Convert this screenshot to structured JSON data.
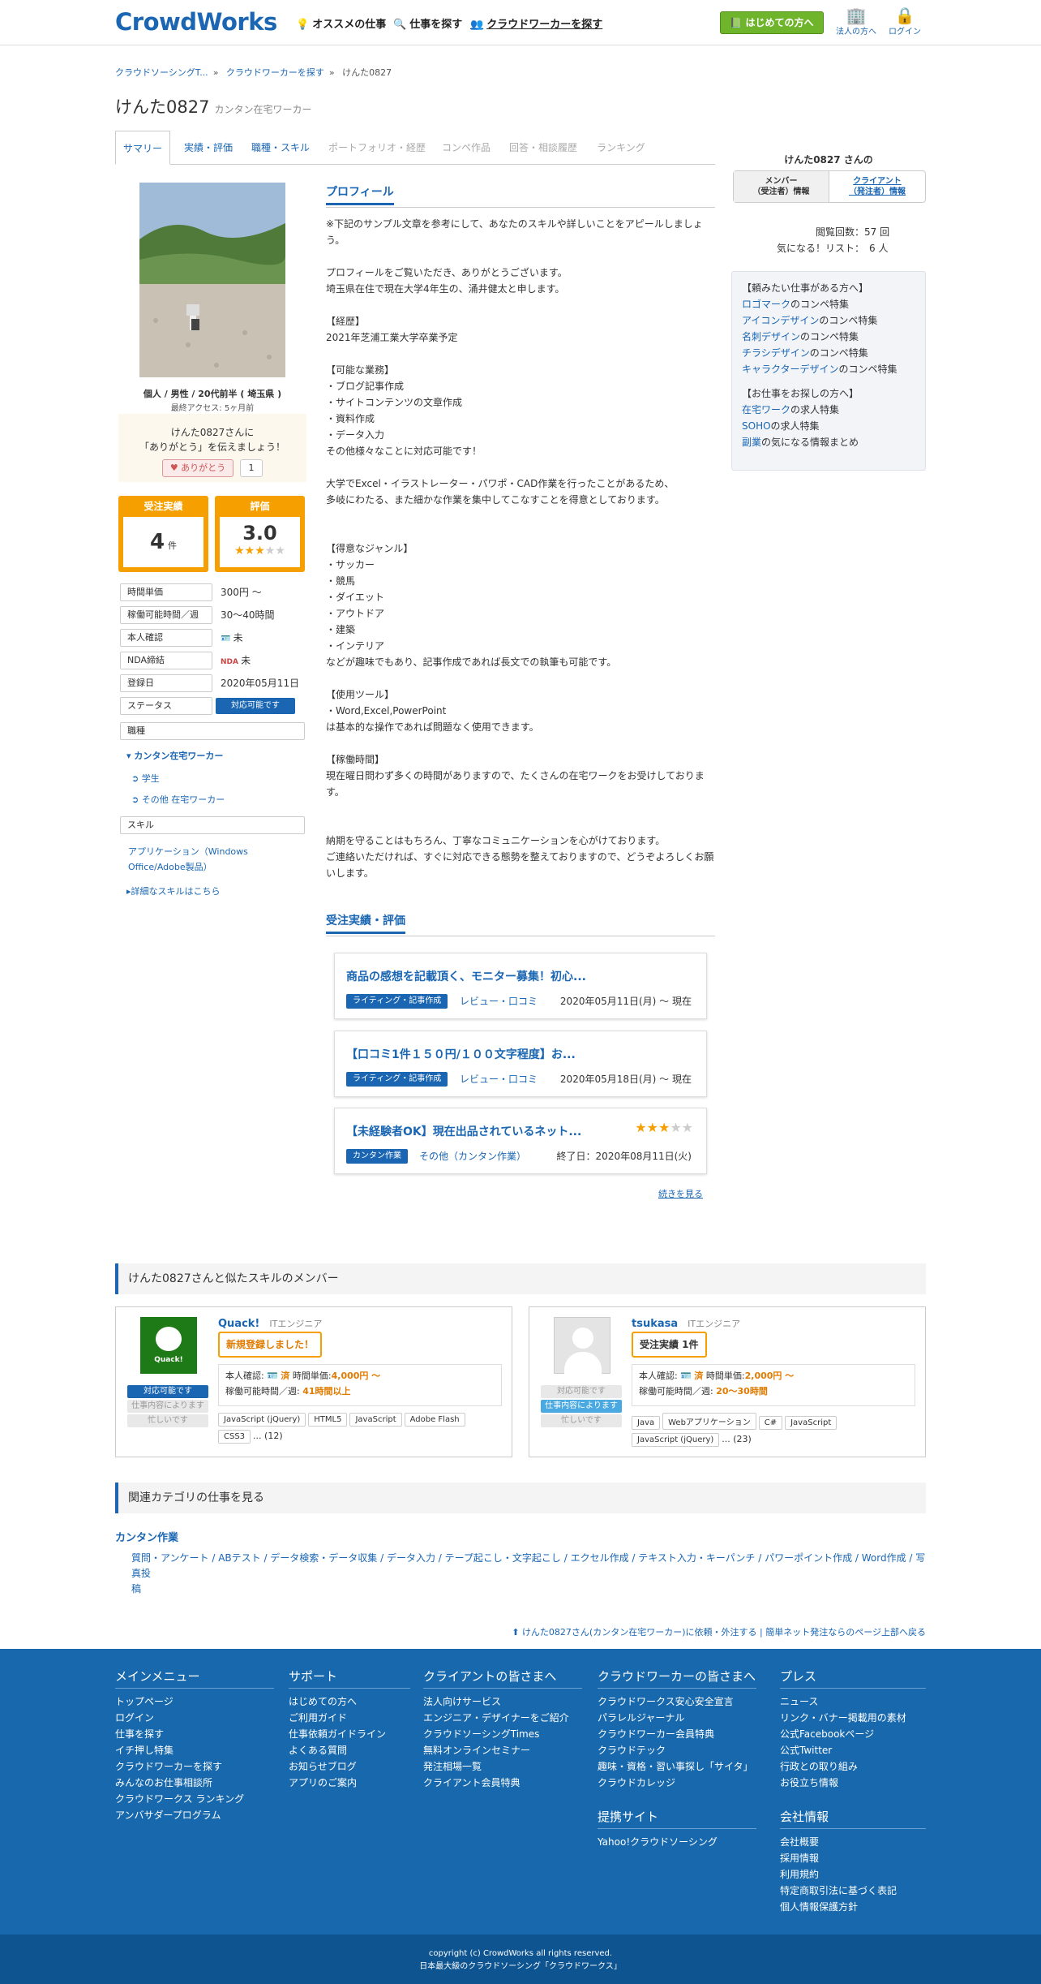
{
  "header": {
    "logo": "CrowdWorks",
    "nav": [
      {
        "icon": "lightbulb-icon",
        "label": "オススメの仕事"
      },
      {
        "icon": "search-icon",
        "label": "仕事を探す"
      },
      {
        "icon": "people-icon",
        "label": "クラウドワーカーを探す"
      }
    ],
    "begin_button": "はじめての方へ",
    "corp_label": "法人の方へ",
    "login_label": "ログイン"
  },
  "breadcrumb": [
    "クラウドソーシングT...",
    "クラウドワーカーを探す",
    "けんた0827"
  ],
  "profile": {
    "name": "けんた0827",
    "role": "カンタン在宅ワーカー"
  },
  "tabs": [
    {
      "label": "サマリー",
      "state": "active"
    },
    {
      "label": "実績・評価",
      "state": "link"
    },
    {
      "label": "職種・スキル",
      "state": "link"
    },
    {
      "label": "ポートフォリオ・経歴",
      "state": "disabled"
    },
    {
      "label": "コンペ作品",
      "state": "disabled"
    },
    {
      "label": "回答・相談履歴",
      "state": "disabled"
    },
    {
      "label": "ランキング",
      "state": "disabled"
    }
  ],
  "left": {
    "info": "個人 / 男性 / 20代前半 ( 埼玉県 )",
    "last_access": "最終アクセス: 5ヶ月前",
    "thanks_line1": "けんた0827さんに",
    "thanks_line2": "「ありがとう」を伝えましょう！",
    "thanks_button": "ありがとう",
    "thanks_count": "1",
    "orders_label": "受注実績",
    "orders_value": "4",
    "orders_unit": "件",
    "rating_label": "評価",
    "rating_value": "3.0",
    "rating_stars": 3,
    "rows": [
      {
        "label": "時間単価",
        "value": "300円 〜"
      },
      {
        "label": "稼働可能時間／週",
        "value": "30〜40時間"
      },
      {
        "label": "本人確認",
        "value": "未"
      },
      {
        "label": "NDA締結",
        "value": "未"
      },
      {
        "label": "登録日",
        "value": "2020年05月11日"
      },
      {
        "label": "ステータス",
        "value": "対応可能です"
      }
    ],
    "job_section": "職種",
    "job_main": "カンタン在宅ワーカー",
    "job_sub": [
      "学生",
      "その他 在宅ワーカー"
    ],
    "skill_section": "スキル",
    "skill_line1": "アプリケーション（Windows",
    "skill_line2": "Office/Adobe製品）",
    "skill_more": "詳細なスキルはこちら"
  },
  "main": {
    "profile_heading": "プロフィール",
    "profile_text": "※下記のサンプル文章を参考にして、あなたのスキルや詳しいことをアピールしましょ\nう。\n\nプロフィールをご覧いただき、ありがとうございます。\n埼玉県在住で現在大学4年生の、涌井健太と申します。\n\n【経歴】\n2021年芝浦工業大学卒業予定\n\n【可能な業務】\n・ブログ記事作成\n・サイトコンテンツの文章作成\n・資料作成\n・データ入力\nその他様々なことに対応可能です！\n\n大学でExcel・イラストレーター・パワポ・CAD作業を行ったことがあるため、\n多岐にわたる、また細かな作業を集中してこなすことを得意としております。\n\n\n【得意なジャンル】\n・サッカー\n・競馬\n・ダイエット\n・アウトドア\n・建築\n・インテリア\nなどが趣味でもあり、記事作成であれば長文での執筆も可能です。\n\n【使用ツール】\n・Word,Excel,PowerPoint\nは基本的な操作であれば問題なく使用できます。\n\n【稼働時間】\n現在曜日問わず多くの時間がありますので、たくさんの在宅ワークをお受けしておりま\nす。\n\n\n納期を守ることはもちろん、丁寧なコミュニケーションを心がけております。\nご連絡いただければ、すぐに対応できる態勢を整えておりますので、どうぞよろしくお願\nいします。",
    "works_heading": "受注実績・評価",
    "works": [
      {
        "title": "商品の感想を記載頂く、モニター募集！初心...",
        "tag": "ライティング・記事作成",
        "category": "レビュー・口コミ",
        "date": "2020年05月11日(月) 〜 現在"
      },
      {
        "title": "【口コミ1件１５０円/１００文字程度】お...",
        "tag": "ライティング・記事作成",
        "category": "レビュー・口コミ",
        "date": "2020年05月18日(月) 〜 現在"
      },
      {
        "title": "【未経験者OK】現在出品されているネット...",
        "tag": "カンタン作業",
        "category": "その他（カンタン作業）",
        "date": "終了日：2020年08月11日(火)",
        "stars": 3
      }
    ],
    "more_link": "続きを見る"
  },
  "right": {
    "title": "けんた0827 さんの",
    "tab1": [
      "メンバー",
      "（受注者）情報"
    ],
    "tab2": [
      "クライアント",
      "（発注者）情報"
    ],
    "views_label": "閲覧回数：",
    "views_value": "57 回",
    "fav_label": "気になる！リスト：",
    "fav_value": "6 人",
    "box_head1": "【頼みたい仕事がある方へ】",
    "box_links1": [
      {
        "link": "ロゴマーク",
        "rest": "のコンペ特集"
      },
      {
        "link": "アイコンデザイン",
        "rest": "のコンペ特集"
      },
      {
        "link": "名刺デザイン",
        "rest": "のコンペ特集"
      },
      {
        "link": "チラシデザイン",
        "rest": "のコンペ特集"
      },
      {
        "link": "キャラクターデザイン",
        "rest": "のコンペ特集"
      }
    ],
    "box_head2": "【お仕事をお探しの方へ】",
    "box_links2": [
      {
        "link": "在宅ワーク",
        "rest": "の求人特集"
      },
      {
        "link": "SOHO",
        "rest": "の求人特集"
      },
      {
        "link": "副業",
        "rest": "の気になる情報まとめ"
      }
    ]
  },
  "similar": {
    "heading": "けんた0827さんと似たスキルのメンバー",
    "members": [
      {
        "name": "Quack!",
        "role": "ITエンジニア",
        "badge": "新規登録しました！",
        "avatar_text": "Quack!",
        "id_label": "本人確認:",
        "id_value": "済",
        "rate_label": "時間単価:",
        "rate_value": "4,000円 〜",
        "hours_label": "稼働可能時間／週:",
        "hours_value": "41時間以上",
        "status": [
          "対応可能です",
          "仕事内容によります",
          "忙しいです"
        ],
        "active_status": 0,
        "skills": [
          "JavaScript (jQuery)",
          "HTML5",
          "JavaScript",
          "Adobe Flash",
          "CSS3"
        ],
        "more": "... (12)"
      },
      {
        "name": "tsukasa",
        "role": "ITエンジニア",
        "badge": "受注実績 1件",
        "id_label": "本人確認:",
        "id_value": "済",
        "rate_label": "時間単価:",
        "rate_value": "2,000円 〜",
        "hours_label": "稼働可能時間／週:",
        "hours_value": "20〜30時間",
        "status": [
          "対応可能です",
          "仕事内容によります",
          "忙しいです"
        ],
        "active_status": 1,
        "skills": [
          "Java",
          "Webアプリケーション",
          "C#",
          "JavaScript",
          "JavaScript (jQuery)"
        ],
        "more": "... (23)"
      }
    ]
  },
  "related": {
    "heading": "関連カテゴリの仕事を見る",
    "category": "カンタン作業",
    "links_line1": "質問・アンケート / ABテスト / データ検索・データ収集 / データ入力 / テープ起こし・文字起こし / エクセル作成 / テキスト入力・キーパンチ / パワーポイント作成 / Word作成 / 写真投",
    "links_line2": "稿"
  },
  "back_link": "けんた0827さん(カンタン在宅ワーカー)に依頼・外注する | 簡単ネット発注ならのページ上部へ戻る",
  "footer": {
    "cols": [
      {
        "heading": "メインメニュー",
        "items": [
          "トップページ",
          "ログイン",
          "仕事を探す",
          "イチ押し特集",
          "クラウドワーカーを探す",
          "みんなのお仕事相談所",
          "クラウドワークス ランキング",
          "アンバサダープログラム"
        ]
      },
      {
        "heading": "サポート",
        "items": [
          "はじめての方へ",
          "ご利用ガイド",
          "仕事依頼ガイドライン",
          "よくある質問",
          "お知らせブログ",
          "アプリのご案内"
        ]
      },
      {
        "heading": "クライアントの皆さまへ",
        "items": [
          "法人向けサービス",
          "エンジニア・デザイナーをご紹介",
          "クラウドソーシングTimes",
          "無料オンラインセミナー",
          "発注相場一覧",
          "クライアント会員特典"
        ]
      },
      {
        "heading": "クラウドワーカーの皆さまへ",
        "items": [
          "クラウドワークス安心安全宣言",
          "パラレルジャーナル",
          "クラウドワーカー会員特典",
          "クラウドテック",
          "趣味・資格・習い事探し「サイタ」",
          "クラウドカレッジ"
        ]
      },
      {
        "heading": "プレス",
        "items": [
          "ニュース",
          "リンク・バナー掲載用の素材",
          "公式Facebookページ",
          "公式Twitter",
          "行政との取り組み",
          "お役立ち情報"
        ]
      }
    ],
    "partner_heading": "提携サイト",
    "partner_items": [
      "Yahoo!クラウドソーシング"
    ],
    "company_heading": "会社情報",
    "company_items": [
      "会社概要",
      "採用情報",
      "利用規約",
      "特定商取引法に基づく表記",
      "個人情報保護方針"
    ],
    "copyright1": "copyright (c) CrowdWorks all rights reserved.",
    "copyright2": "日本最大級のクラウドソーシング「クラウドワークス」"
  },
  "colors": {
    "primary": "#1a66b3",
    "accent": "#f5a000",
    "green": "#6fb52c",
    "footer": "#1768ac"
  }
}
